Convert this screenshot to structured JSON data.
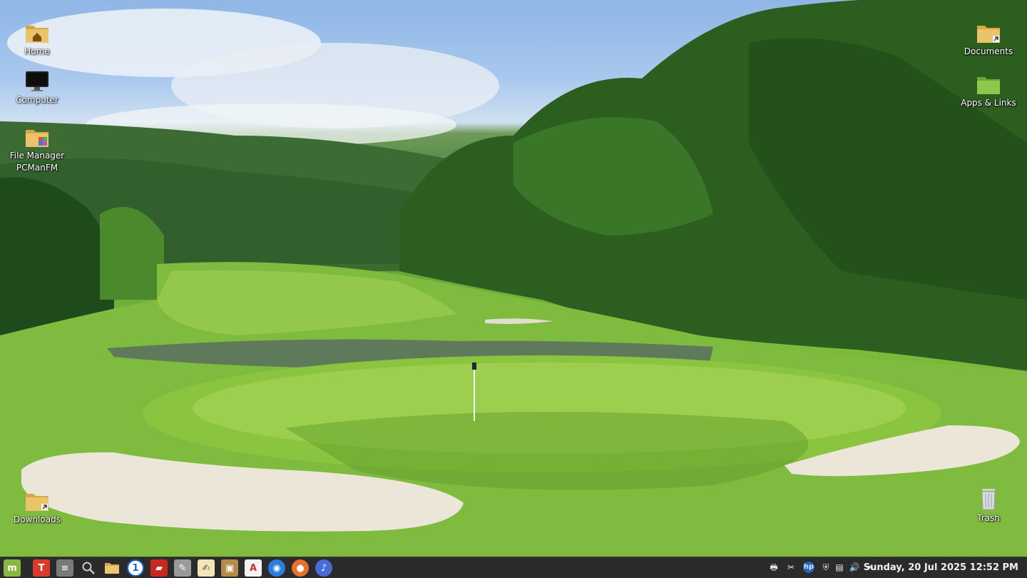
{
  "desktop": {
    "icons_left": [
      {
        "label": "Home"
      },
      {
        "label": "Computer"
      },
      {
        "label": "File Manager",
        "label2": "PCManFM"
      },
      {
        "label": "Downloads"
      }
    ],
    "icons_right": [
      {
        "label": "Documents"
      },
      {
        "label": "Apps & Links"
      },
      {
        "label": "Trash"
      }
    ]
  },
  "taskbar": {
    "launchers": [
      {
        "icon": "mint-menu-icon",
        "color": "#87b940"
      },
      {
        "icon": "text-editor-icon",
        "color": "#d83b2b"
      },
      {
        "icon": "mixer-settings-icon",
        "color": "#7a7a7a"
      },
      {
        "icon": "search-icon",
        "color": "#444444"
      },
      {
        "icon": "folder-icon",
        "color": "#e0b860"
      },
      {
        "icon": "password-manager-icon",
        "color": "#1e63c8"
      },
      {
        "icon": "reader-icon",
        "color": "#c8281e"
      },
      {
        "icon": "system-tool-icon",
        "color": "#9a9a9a"
      },
      {
        "icon": "notes-icon",
        "color": "#f0e6b8"
      },
      {
        "icon": "archive-icon",
        "color": "#b58a4a"
      },
      {
        "icon": "pdf-icon",
        "color": "#c83228"
      },
      {
        "icon": "browser-icon",
        "color": "#2a7de0"
      },
      {
        "icon": "firefox-icon",
        "color": "#e8702a"
      },
      {
        "icon": "media-player-icon",
        "color": "#4a6ad8"
      }
    ],
    "tray": [
      {
        "icon": "printer-icon"
      },
      {
        "icon": "network-tool-icon"
      },
      {
        "icon": "hp-icon"
      },
      {
        "icon": "shield-icon"
      },
      {
        "icon": "clipboard-icon"
      },
      {
        "icon": "volume-icon"
      },
      {
        "icon": "pen-icon"
      }
    ],
    "clock": "Sunday, 20 Jul 2025 12:52 PM"
  }
}
